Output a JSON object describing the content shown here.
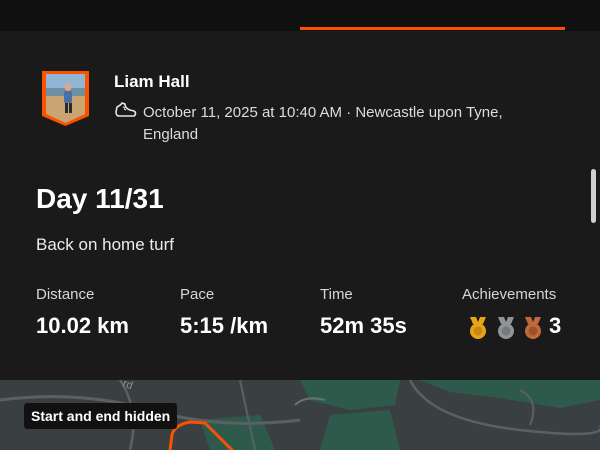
{
  "athlete": {
    "name": "Liam Hall",
    "activity_icon": "running-shoe-icon"
  },
  "activity": {
    "meta": "October 11, 2025 at 10:40 AM · Newcastle upon Tyne, England",
    "title": "Day 11/31",
    "description": "Back on home turf"
  },
  "stats": {
    "distance": {
      "label": "Distance",
      "value": "10.02 km"
    },
    "pace": {
      "label": "Pace",
      "value": "5:15 /km"
    },
    "time": {
      "label": "Time",
      "value": "52m 35s"
    },
    "achievements": {
      "label": "Achievements",
      "count": "3",
      "medals": [
        "gold-medal-icon",
        "silver-medal-icon",
        "bronze-medal-icon"
      ]
    }
  },
  "map": {
    "badge": "Start and end hidden"
  },
  "colors": {
    "accent": "#fc5200",
    "background": "#1a1a1a",
    "gold": "#e8a317",
    "silver": "#8e9497",
    "bronze": "#c0693a"
  }
}
